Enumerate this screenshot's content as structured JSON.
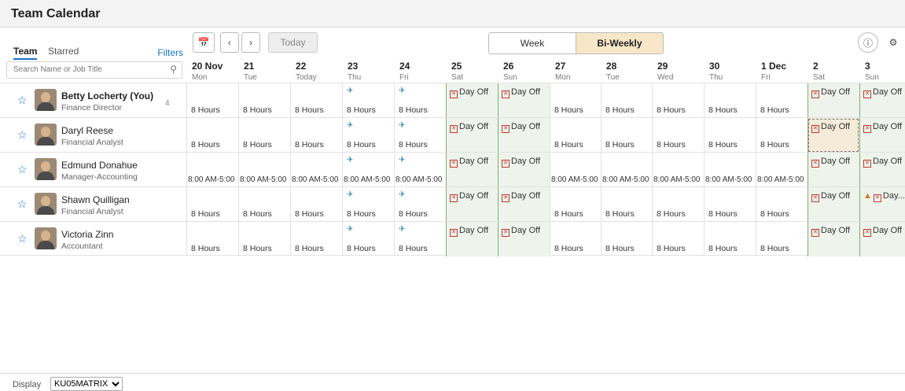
{
  "title": "Team Calendar",
  "tabs": {
    "team": "Team",
    "starred": "Starred",
    "filters": "Filters"
  },
  "search": {
    "placeholder": "Search Name or Job Title"
  },
  "toolbar": {
    "today": "Today",
    "week": "Week",
    "biweekly": "Bi-Weekly"
  },
  "days": [
    {
      "date": "20 Nov",
      "weekday": "Mon"
    },
    {
      "date": "21",
      "weekday": "Tue"
    },
    {
      "date": "22",
      "weekday": "Today"
    },
    {
      "date": "23",
      "weekday": "Thu"
    },
    {
      "date": "24",
      "weekday": "Fri"
    },
    {
      "date": "25",
      "weekday": "Sat"
    },
    {
      "date": "26",
      "weekday": "Sun"
    },
    {
      "date": "27",
      "weekday": "Mon"
    },
    {
      "date": "28",
      "weekday": "Tue"
    },
    {
      "date": "29",
      "weekday": "Wed"
    },
    {
      "date": "30",
      "weekday": "Thu"
    },
    {
      "date": "1 Dec",
      "weekday": "Fri"
    },
    {
      "date": "2",
      "weekday": "Sat"
    },
    {
      "date": "3",
      "weekday": "Sun"
    }
  ],
  "employees": [
    {
      "name": "Betty Locherty (You)",
      "title": "Finance Director",
      "count": "4",
      "cells": [
        "8 Hours",
        "8 Hours",
        "8 Hours",
        "8 Hours",
        "8 Hours",
        "Day Off",
        "Day Off",
        "8 Hours",
        "8 Hours",
        "8 Hours",
        "8 Hours",
        "8 Hours",
        "Day Off",
        "Day Off"
      ]
    },
    {
      "name": "Daryl Reese",
      "title": "Financial Analyst",
      "count": "",
      "cells": [
        "8 Hours",
        "8 Hours",
        "8 Hours",
        "8 Hours",
        "8 Hours",
        "Day Off",
        "Day Off",
        "8 Hours",
        "8 Hours",
        "8 Hours",
        "8 Hours",
        "8 Hours",
        "Day Off",
        "Day Off"
      ]
    },
    {
      "name": "Edmund Donahue",
      "title": "Manager-Accounting",
      "count": "",
      "cells": [
        "8:00 AM-5:00",
        "8:00 AM-5:00",
        "8:00 AM-5:00",
        "8:00 AM-5:00",
        "8:00 AM-5:00",
        "Day Off",
        "Day Off",
        "8:00 AM-5:00",
        "8:00 AM-5:00",
        "8:00 AM-5:00",
        "8:00 AM-5:00",
        "8:00 AM-5:00",
        "Day Off",
        "Day Off"
      ]
    },
    {
      "name": "Shawn Quilligan",
      "title": "Financial Analyst",
      "count": "",
      "cells": [
        "8 Hours",
        "8 Hours",
        "8 Hours",
        "8 Hours",
        "8 Hours",
        "Day Off",
        "Day Off",
        "8 Hours",
        "8 Hours",
        "8 Hours",
        "8 Hours",
        "8 Hours",
        "Day Off",
        "Day..."
      ]
    },
    {
      "name": "Victoria Zinn",
      "title": "Accountant",
      "count": "",
      "cells": [
        "8 Hours",
        "8 Hours",
        "8 Hours",
        "8 Hours",
        "8 Hours",
        "Day Off",
        "Day Off",
        "8 Hours",
        "8 Hours",
        "8 Hours",
        "8 Hours",
        "8 Hours",
        "Day Off",
        "Day Off"
      ]
    }
  ],
  "footer": {
    "display_label": "Display",
    "display_value": "KU05MATRIX"
  },
  "colors": {
    "accent": "#1a73c8",
    "weekend": "#eef3ec",
    "selected_tab": "#f7e6c8",
    "dayoff_icon": "#c0392b"
  }
}
